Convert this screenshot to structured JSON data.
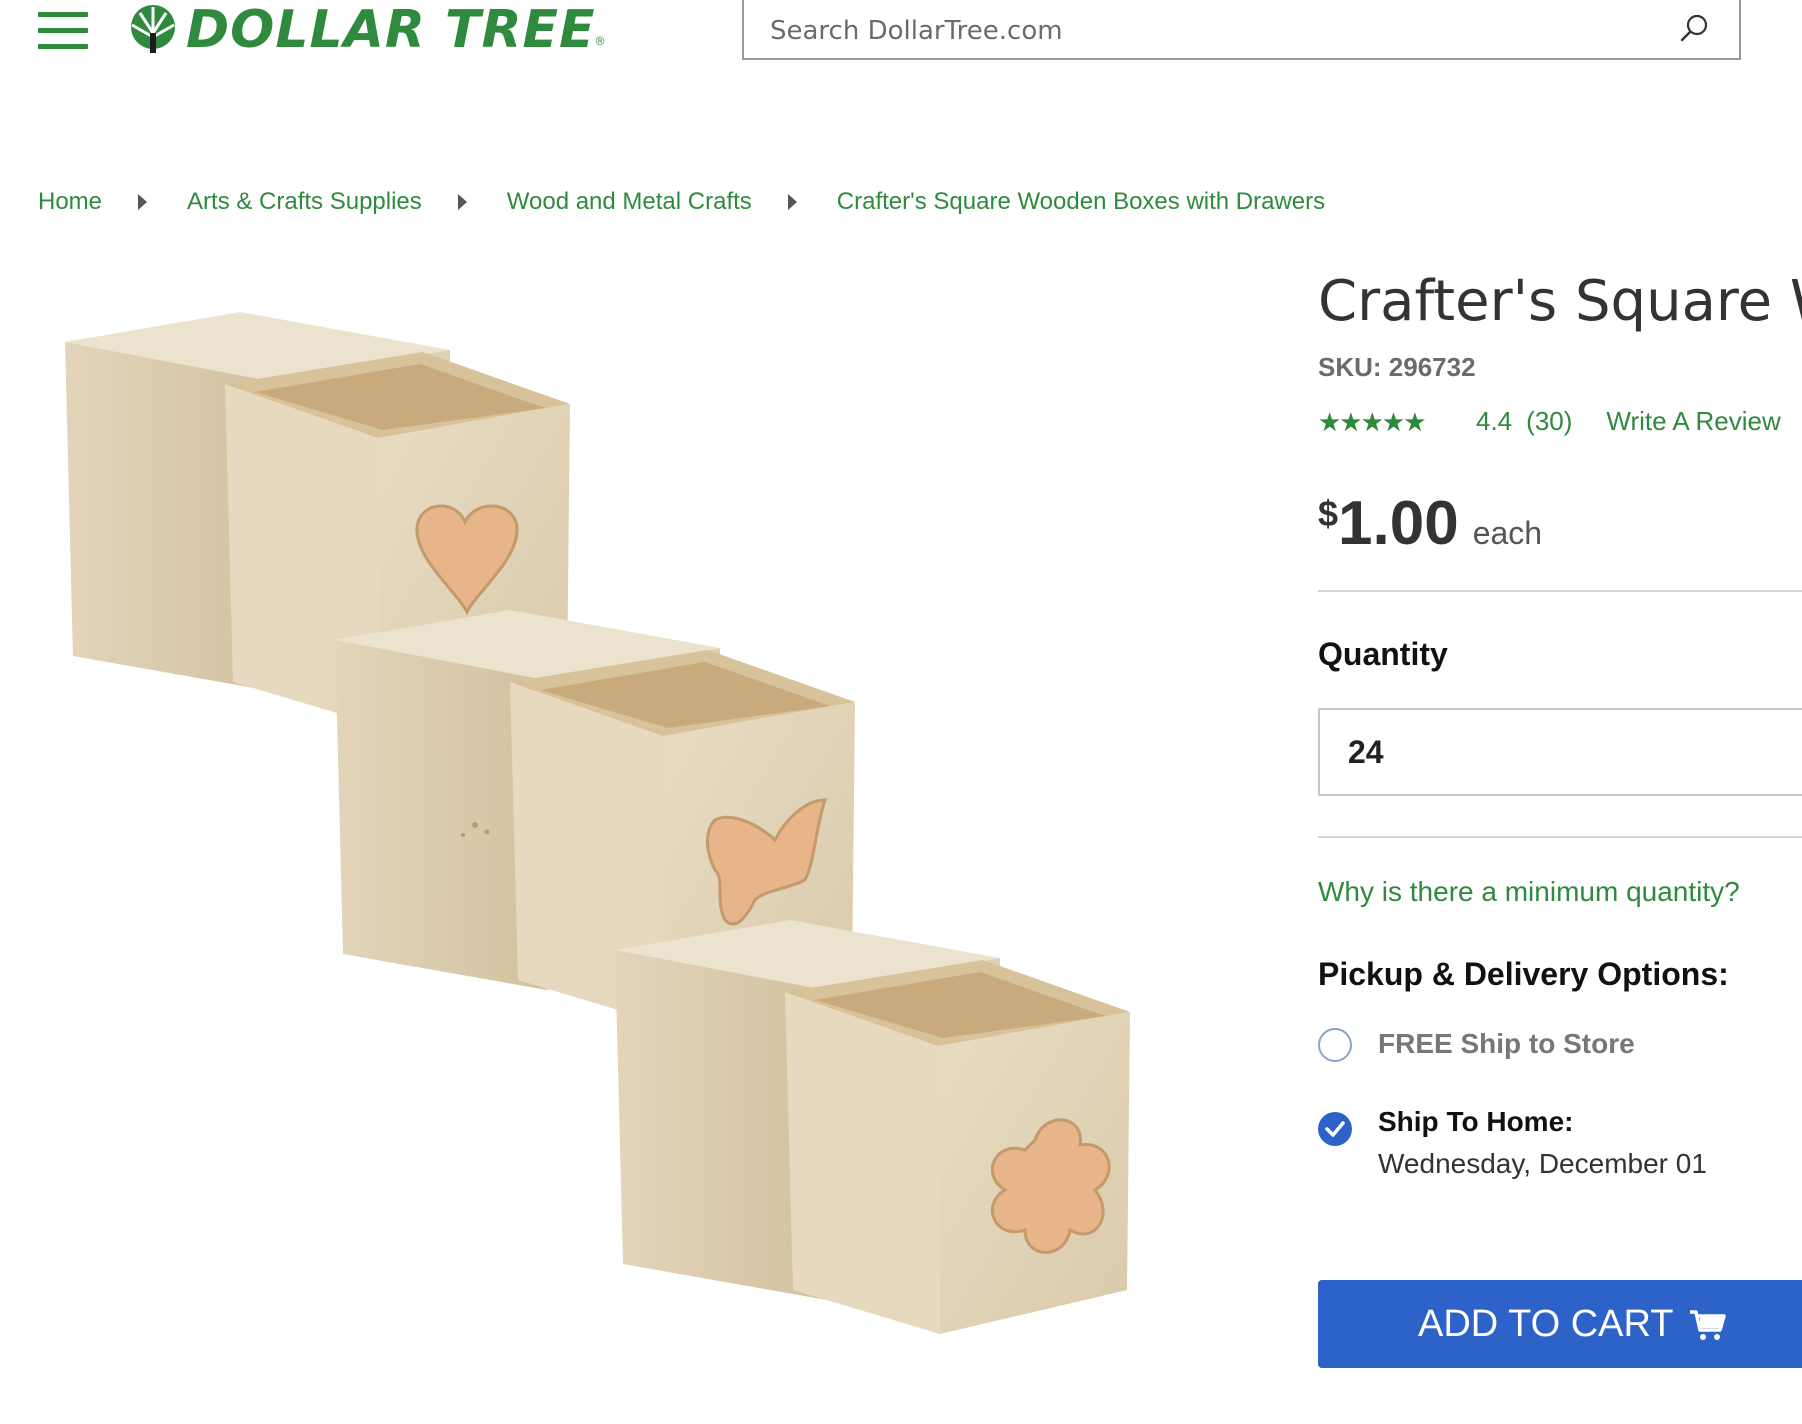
{
  "header": {
    "logo_text": "DOLLAR TREE",
    "logo_reg": "®",
    "search_placeholder": "Search DollarTree.com"
  },
  "breadcrumb": [
    {
      "label": "Home"
    },
    {
      "label": "Arts & Crafts Supplies"
    },
    {
      "label": "Wood and Metal Crafts"
    },
    {
      "label": "Crafter's Square Wooden Boxes with Drawers"
    }
  ],
  "product": {
    "title": "Crafter's Square Wooden Boxes with Drawers",
    "sku": "SKU: 296732",
    "rating": 4.4,
    "rating_max": 5,
    "rating_value_text": "4.4",
    "rating_count": "(30)",
    "write_review": "Write A Review",
    "price_symbol": "$",
    "price": "1.00",
    "price_unit": "each",
    "quantity_label": "Quantity",
    "quantity_value": "24",
    "min_qty_link": "Why is there a minimum quantity?",
    "pickup_title": "Pickup & Delivery Options:",
    "options": [
      {
        "label": "FREE Ship to Store",
        "selected": false
      },
      {
        "label": "Ship To Home:",
        "sub": "Wednesday, December 01",
        "selected": true
      }
    ],
    "add_to_cart": "ADD TO CART"
  },
  "colors": {
    "brand_green": "#2f8a3d",
    "button_blue": "#2d63c8"
  },
  "icons": [
    "menu-icon",
    "tree-logo-icon",
    "search-icon",
    "caret-right-icon",
    "star-icon",
    "check-icon",
    "cart-icon"
  ]
}
